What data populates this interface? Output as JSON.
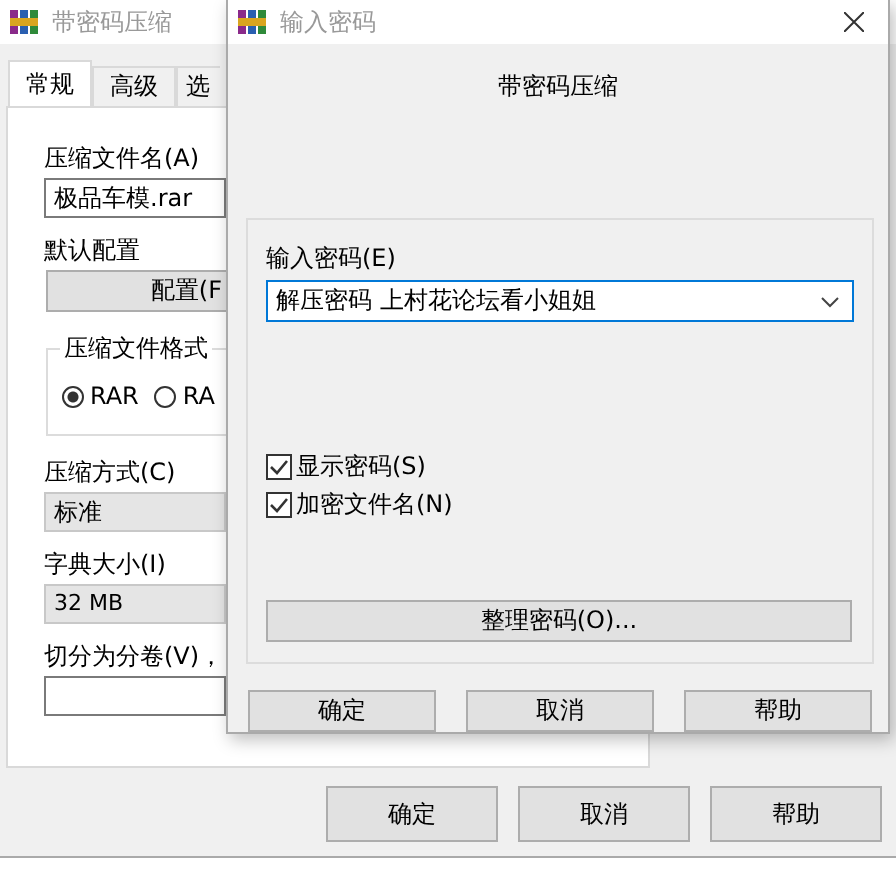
{
  "main_window": {
    "title": "带密码压缩",
    "tabs": [
      {
        "label": "常规",
        "selected": true
      },
      {
        "label": "高级",
        "selected": false
      },
      {
        "label": "选",
        "selected": false
      }
    ],
    "archive_name_label": "压缩文件名(A)",
    "archive_name": "极品车模.rar",
    "profile_label": "默认配置",
    "profile_button": "配置(F",
    "format_group": "压缩文件格式",
    "formats": [
      {
        "label": "RAR",
        "selected": true
      },
      {
        "label": "RA",
        "selected": false
      }
    ],
    "method_label": "压缩方式(C)",
    "method": "标准",
    "dictionary_label": "字典大小(I)",
    "dictionary": "32 MB",
    "split_label": "切分为分卷(V)，",
    "buttons": [
      "确定",
      "取消",
      "帮助"
    ]
  },
  "dialog": {
    "title": "输入密码",
    "heading": "带密码压缩",
    "password_label": "输入密码(E)",
    "password": "解压密码  上村花论坛看小姐姐",
    "options": [
      {
        "label": "显示密码(S)",
        "checked": true
      },
      {
        "label": "加密文件名(N)",
        "checked": true
      }
    ],
    "organize_button": "整理密码(O)...",
    "buttons": [
      "确定",
      "取消",
      "帮助"
    ]
  }
}
